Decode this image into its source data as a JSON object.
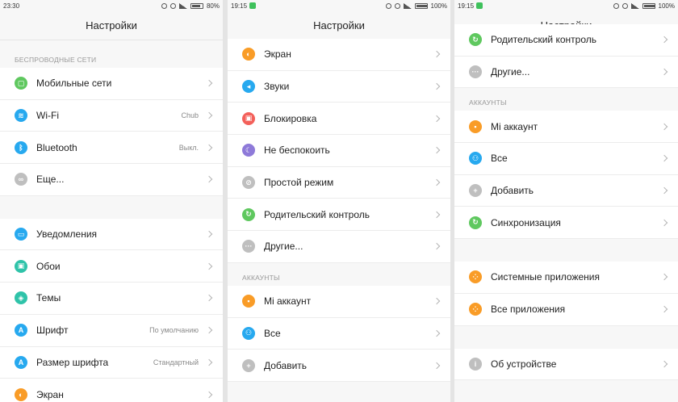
{
  "panels": [
    {
      "status": {
        "time": "23:30",
        "battery": "80%"
      },
      "title": "Настройки",
      "sections": [
        {
          "header": "Беспроводные сети",
          "items": [
            {
              "label": "Мобильные сети",
              "value": "",
              "icon": "sim-icon",
              "color": "#5fc85f",
              "glyph": "▢"
            },
            {
              "label": "Wi-Fi",
              "value": "Chub",
              "icon": "wifi-icon",
              "color": "#27a9ef",
              "glyph": "≋"
            },
            {
              "label": "Bluetooth",
              "value": "Выкл.",
              "icon": "bluetooth-icon",
              "color": "#27a9ef",
              "glyph": "ᛒ"
            },
            {
              "label": "Еще...",
              "value": "",
              "icon": "link-icon",
              "color": "#bfbfbf",
              "glyph": "∞"
            }
          ]
        },
        {
          "header": "",
          "items": [
            {
              "label": "Уведомления",
              "value": "",
              "icon": "notification-icon",
              "color": "#27a9ef",
              "glyph": "▭"
            },
            {
              "label": "Обои",
              "value": "",
              "icon": "wallpaper-icon",
              "color": "#2fc3a9",
              "glyph": "▣"
            },
            {
              "label": "Темы",
              "value": "",
              "icon": "theme-icon",
              "color": "#2fc3a9",
              "glyph": "◈"
            },
            {
              "label": "Шрифт",
              "value": "По умолчанию",
              "icon": "font-icon",
              "color": "#27a9ef",
              "glyph": "A"
            },
            {
              "label": "Размер шрифта",
              "value": "Стандартный",
              "icon": "font-size-icon",
              "color": "#27a9ef",
              "glyph": "A"
            },
            {
              "label": "Экран",
              "value": "",
              "icon": "display-icon",
              "color": "#f99c27",
              "glyph": "◐"
            }
          ]
        }
      ]
    },
    {
      "status": {
        "time": "19:15",
        "battery": "100%"
      },
      "title": "Настройки",
      "sections": [
        {
          "header": "",
          "items": [
            {
              "label": "Экран",
              "value": "",
              "icon": "display-icon",
              "color": "#f99c27",
              "glyph": "◐"
            },
            {
              "label": "Звуки",
              "value": "",
              "icon": "sound-icon",
              "color": "#27a9ef",
              "glyph": "◂"
            },
            {
              "label": "Блокировка",
              "value": "",
              "icon": "lock-icon",
              "color": "#f3605a",
              "glyph": "▣"
            },
            {
              "label": "Не беспокоить",
              "value": "",
              "icon": "moon-icon",
              "color": "#8e7ad9",
              "glyph": "☾"
            },
            {
              "label": "Простой режим",
              "value": "",
              "icon": "simple-mode-icon",
              "color": "#bfbfbf",
              "glyph": "⊘"
            },
            {
              "label": "Родительский контроль",
              "value": "",
              "icon": "parental-icon",
              "color": "#5fc85f",
              "glyph": "↻"
            },
            {
              "label": "Другие...",
              "value": "",
              "icon": "more-icon",
              "color": "#bfbfbf",
              "glyph": "···"
            }
          ]
        },
        {
          "header": "Аккаунты",
          "items": [
            {
              "label": "Mi аккаунт",
              "value": "",
              "icon": "mi-account-icon",
              "color": "#f99c27",
              "glyph": "▪"
            },
            {
              "label": "Все",
              "value": "",
              "icon": "person-icon",
              "color": "#27a9ef",
              "glyph": "⚇"
            },
            {
              "label": "Добавить",
              "value": "",
              "icon": "add-icon",
              "color": "#bfbfbf",
              "glyph": "+"
            }
          ]
        }
      ]
    },
    {
      "status": {
        "time": "19:15",
        "battery": "100%"
      },
      "title": "Настройки",
      "sections": [
        {
          "header": "",
          "items": [
            {
              "label": "Родительский контроль",
              "value": "",
              "icon": "parental-icon",
              "color": "#5fc85f",
              "glyph": "↻"
            },
            {
              "label": "Другие...",
              "value": "",
              "icon": "more-icon",
              "color": "#bfbfbf",
              "glyph": "···"
            }
          ]
        },
        {
          "header": "Аккаунты",
          "items": [
            {
              "label": "Mi аккаунт",
              "value": "",
              "icon": "mi-account-icon",
              "color": "#f99c27",
              "glyph": "▪"
            },
            {
              "label": "Все",
              "value": "",
              "icon": "person-icon",
              "color": "#27a9ef",
              "glyph": "⚇"
            },
            {
              "label": "Добавить",
              "value": "",
              "icon": "add-icon",
              "color": "#bfbfbf",
              "glyph": "+"
            },
            {
              "label": "Синхронизация",
              "value": "",
              "icon": "sync-icon",
              "color": "#5fc85f",
              "glyph": "↻"
            }
          ]
        },
        {
          "header": "",
          "items": [
            {
              "label": "Системные приложения",
              "value": "",
              "icon": "system-apps-icon",
              "color": "#f99c27",
              "glyph": "⁘"
            },
            {
              "label": "Все приложения",
              "value": "",
              "icon": "all-apps-icon",
              "color": "#f99c27",
              "glyph": "⁘"
            }
          ]
        },
        {
          "header": "",
          "items": [
            {
              "label": "Об устройстве",
              "value": "",
              "icon": "info-icon",
              "color": "#bfbfbf",
              "glyph": "i"
            }
          ]
        }
      ]
    }
  ]
}
